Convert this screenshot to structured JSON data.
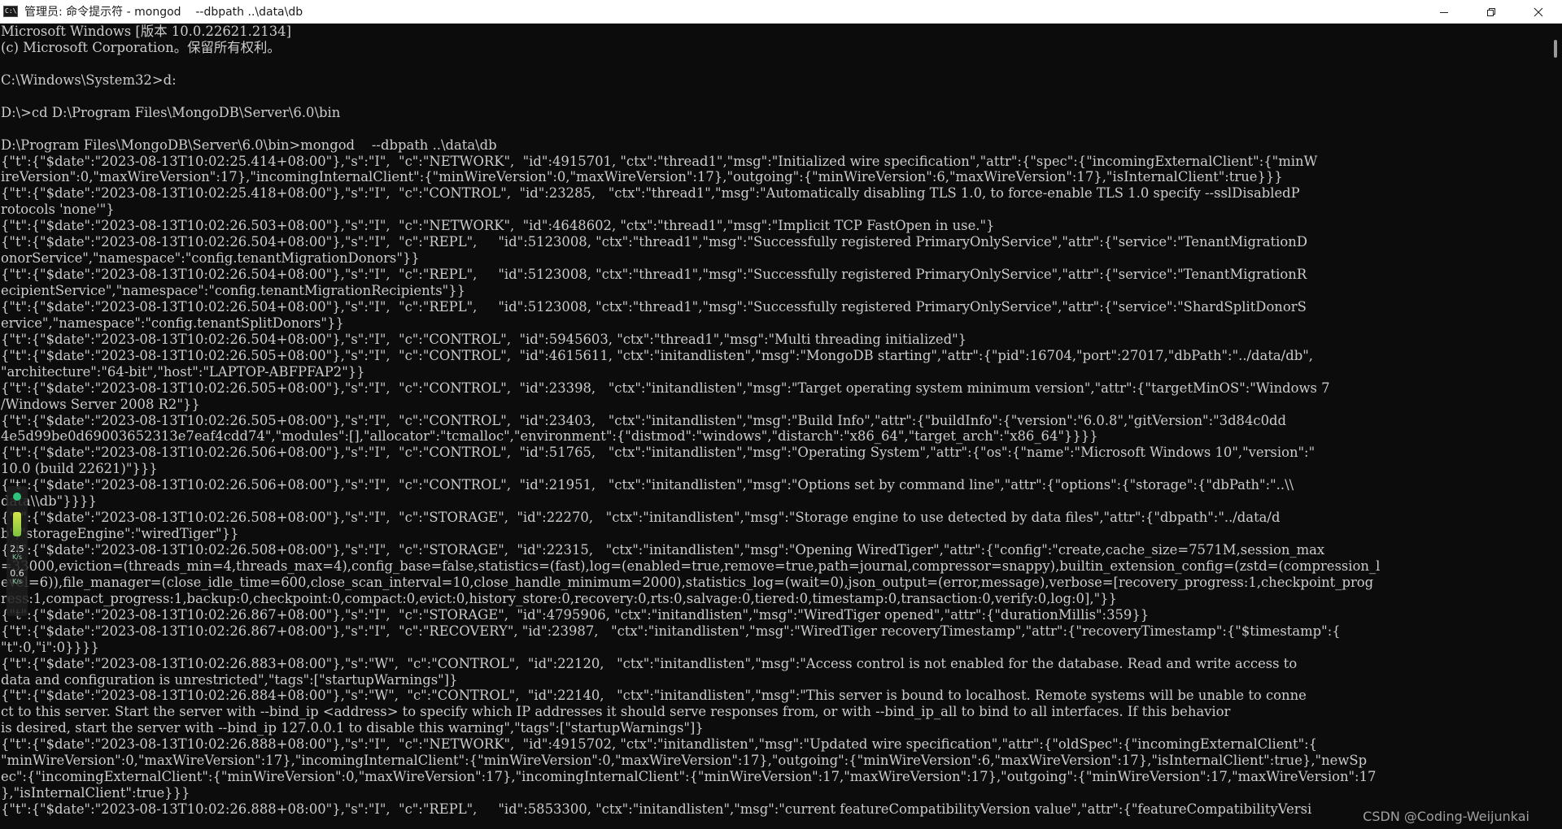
{
  "window": {
    "title": "管理员: 命令提示符 - mongod    --dbpath ..\\data\\db",
    "icon_label": "C:\\",
    "controls": [
      {
        "name": "minimize",
        "icon": "minimize-icon"
      },
      {
        "name": "restore",
        "icon": "restore-icon"
      },
      {
        "name": "close",
        "icon": "close-icon"
      }
    ]
  },
  "colors": {
    "background": "#0c0c0c",
    "text": "#cccccc",
    "titlebar": "#ffffff"
  },
  "console": {
    "lines": [
      "Microsoft Windows [版本 10.0.22621.2134]",
      "(c) Microsoft Corporation。保留所有权利。",
      "",
      "C:\\Windows\\System32>d:",
      "",
      "D:\\>cd D:\\Program Files\\MongoDB\\Server\\6.0\\bin",
      "",
      "D:\\Program Files\\MongoDB\\Server\\6.0\\bin>mongod    --dbpath ..\\data\\db",
      "{\"t\":{\"$date\":\"2023-08-13T10:02:25.414+08:00\"},\"s\":\"I\",  \"c\":\"NETWORK\",  \"id\":4915701, \"ctx\":\"thread1\",\"msg\":\"Initialized wire specification\",\"attr\":{\"spec\":{\"incomingExternalClient\":{\"minW",
      "ireVersion\":0,\"maxWireVersion\":17},\"incomingInternalClient\":{\"minWireVersion\":0,\"maxWireVersion\":17},\"outgoing\":{\"minWireVersion\":6,\"maxWireVersion\":17},\"isInternalClient\":true}}}",
      "{\"t\":{\"$date\":\"2023-08-13T10:02:25.418+08:00\"},\"s\":\"I\",  \"c\":\"CONTROL\",  \"id\":23285,   \"ctx\":\"thread1\",\"msg\":\"Automatically disabling TLS 1.0, to force-enable TLS 1.0 specify --sslDisabledP",
      "rotocols 'none'\"}",
      "{\"t\":{\"$date\":\"2023-08-13T10:02:26.503+08:00\"},\"s\":\"I\",  \"c\":\"NETWORK\",  \"id\":4648602, \"ctx\":\"thread1\",\"msg\":\"Implicit TCP FastOpen in use.\"}",
      "{\"t\":{\"$date\":\"2023-08-13T10:02:26.504+08:00\"},\"s\":\"I\",  \"c\":\"REPL\",     \"id\":5123008, \"ctx\":\"thread1\",\"msg\":\"Successfully registered PrimaryOnlyService\",\"attr\":{\"service\":\"TenantMigrationD",
      "onorService\",\"namespace\":\"config.tenantMigrationDonors\"}}",
      "{\"t\":{\"$date\":\"2023-08-13T10:02:26.504+08:00\"},\"s\":\"I\",  \"c\":\"REPL\",     \"id\":5123008, \"ctx\":\"thread1\",\"msg\":\"Successfully registered PrimaryOnlyService\",\"attr\":{\"service\":\"TenantMigrationR",
      "ecipientService\",\"namespace\":\"config.tenantMigrationRecipients\"}}",
      "{\"t\":{\"$date\":\"2023-08-13T10:02:26.504+08:00\"},\"s\":\"I\",  \"c\":\"REPL\",     \"id\":5123008, \"ctx\":\"thread1\",\"msg\":\"Successfully registered PrimaryOnlyService\",\"attr\":{\"service\":\"ShardSplitDonorS",
      "ervice\",\"namespace\":\"config.tenantSplitDonors\"}}",
      "{\"t\":{\"$date\":\"2023-08-13T10:02:26.504+08:00\"},\"s\":\"I\",  \"c\":\"CONTROL\",  \"id\":5945603, \"ctx\":\"thread1\",\"msg\":\"Multi threading initialized\"}",
      "{\"t\":{\"$date\":\"2023-08-13T10:02:26.505+08:00\"},\"s\":\"I\",  \"c\":\"CONTROL\",  \"id\":4615611, \"ctx\":\"initandlisten\",\"msg\":\"MongoDB starting\",\"attr\":{\"pid\":16704,\"port\":27017,\"dbPath\":\"../data/db\",",
      "\"architecture\":\"64-bit\",\"host\":\"LAPTOP-ABFPFAP2\"}}",
      "{\"t\":{\"$date\":\"2023-08-13T10:02:26.505+08:00\"},\"s\":\"I\",  \"c\":\"CONTROL\",  \"id\":23398,   \"ctx\":\"initandlisten\",\"msg\":\"Target operating system minimum version\",\"attr\":{\"targetMinOS\":\"Windows 7",
      "/Windows Server 2008 R2\"}}",
      "{\"t\":{\"$date\":\"2023-08-13T10:02:26.505+08:00\"},\"s\":\"I\",  \"c\":\"CONTROL\",  \"id\":23403,   \"ctx\":\"initandlisten\",\"msg\":\"Build Info\",\"attr\":{\"buildInfo\":{\"version\":\"6.0.8\",\"gitVersion\":\"3d84c0dd",
      "4e5d99be0d69003652313e7eaf4cdd74\",\"modules\":[],\"allocator\":\"tcmalloc\",\"environment\":{\"distmod\":\"windows\",\"distarch\":\"x86_64\",\"target_arch\":\"x86_64\"}}}}",
      "{\"t\":{\"$date\":\"2023-08-13T10:02:26.506+08:00\"},\"s\":\"I\",  \"c\":\"CONTROL\",  \"id\":51765,   \"ctx\":\"initandlisten\",\"msg\":\"Operating System\",\"attr\":{\"os\":{\"name\":\"Microsoft Windows 10\",\"version\":\"",
      "10.0 (build 22621)\"}}}",
      "{\"t\":{\"$date\":\"2023-08-13T10:02:26.506+08:00\"},\"s\":\"I\",  \"c\":\"CONTROL\",  \"id\":21951,   \"ctx\":\"initandlisten\",\"msg\":\"Options set by command line\",\"attr\":{\"options\":{\"storage\":{\"dbPath\":\"..\\\\",
      "data\\\\db\"}}}}",
      "{\"t\":{\"$date\":\"2023-08-13T10:02:26.508+08:00\"},\"s\":\"I\",  \"c\":\"STORAGE\",  \"id\":22270,   \"ctx\":\"initandlisten\",\"msg\":\"Storage engine to use detected by data files\",\"attr\":{\"dbpath\":\"../data/d",
      "b\",\"storageEngine\":\"wiredTiger\"}}",
      "{\"t\":{\"$date\":\"2023-08-13T10:02:26.508+08:00\"},\"s\":\"I\",  \"c\":\"STORAGE\",  \"id\":22315,   \"ctx\":\"initandlisten\",\"msg\":\"Opening WiredTiger\",\"attr\":{\"config\":\"create,cache_size=7571M,session_max",
      "=33000,eviction=(threads_min=4,threads_max=4),config_base=false,statistics=(fast),log=(enabled=true,remove=true,path=journal,compressor=snappy),builtin_extension_config=(zstd=(compression_l",
      "evel=6)),file_manager=(close_idle_time=600,close_scan_interval=10,close_handle_minimum=2000),statistics_log=(wait=0),json_output=(error,message),verbose=[recovery_progress:1,checkpoint_prog",
      "ress:1,compact_progress:1,backup:0,checkpoint:0,compact:0,evict:0,history_store:0,recovery:0,rts:0,salvage:0,tiered:0,timestamp:0,transaction:0,verify:0,log:0],\"}}",
      "{\"t\":{\"$date\":\"2023-08-13T10:02:26.867+08:00\"},\"s\":\"I\",  \"c\":\"STORAGE\",  \"id\":4795906, \"ctx\":\"initandlisten\",\"msg\":\"WiredTiger opened\",\"attr\":{\"durationMillis\":359}}",
      "{\"t\":{\"$date\":\"2023-08-13T10:02:26.867+08:00\"},\"s\":\"I\",  \"c\":\"RECOVERY\", \"id\":23987,   \"ctx\":\"initandlisten\",\"msg\":\"WiredTiger recoveryTimestamp\",\"attr\":{\"recoveryTimestamp\":{\"$timestamp\":{",
      "\"t\":0,\"i\":0}}}}",
      "{\"t\":{\"$date\":\"2023-08-13T10:02:26.883+08:00\"},\"s\":\"W\",  \"c\":\"CONTROL\",  \"id\":22120,   \"ctx\":\"initandlisten\",\"msg\":\"Access control is not enabled for the database. Read and write access to",
      "data and configuration is unrestricted\",\"tags\":[\"startupWarnings\"]}",
      "{\"t\":{\"$date\":\"2023-08-13T10:02:26.884+08:00\"},\"s\":\"W\",  \"c\":\"CONTROL\",  \"id\":22140,   \"ctx\":\"initandlisten\",\"msg\":\"This server is bound to localhost. Remote systems will be unable to conne",
      "ct to this server. Start the server with --bind_ip <address> to specify which IP addresses it should serve responses from, or with --bind_ip_all to bind to all interfaces. If this behavior",
      "is desired, start the server with --bind_ip 127.0.0.1 to disable this warning\",\"tags\":[\"startupWarnings\"]}",
      "{\"t\":{\"$date\":\"2023-08-13T10:02:26.888+08:00\"},\"s\":\"I\",  \"c\":\"NETWORK\",  \"id\":4915702, \"ctx\":\"initandlisten\",\"msg\":\"Updated wire specification\",\"attr\":{\"oldSpec\":{\"incomingExternalClient\":{",
      "\"minWireVersion\":0,\"maxWireVersion\":17},\"incomingInternalClient\":{\"minWireVersion\":0,\"maxWireVersion\":17},\"outgoing\":{\"minWireVersion\":6,\"maxWireVersion\":17},\"isInternalClient\":true},\"newSp",
      "ec\":{\"incomingExternalClient\":{\"minWireVersion\":0,\"maxWireVersion\":17},\"incomingInternalClient\":{\"minWireVersion\":17,\"maxWireVersion\":17},\"outgoing\":{\"minWireVersion\":17,\"maxWireVersion\":17",
      "},\"isInternalClient\":true}}}",
      "{\"t\":{\"$date\":\"2023-08-13T10:02:26.888+08:00\"},\"s\":\"I\",  \"c\":\"REPL\",     \"id\":5853300, \"ctx\":\"initandlisten\",\"msg\":\"current featureCompatibilityVersion value\",\"attr\":{\"featureCompatibilityVersi"
    ]
  },
  "overlay": {
    "upload_value": "2.5",
    "upload_unit": "K/s",
    "download_value": "0.6",
    "download_unit": "K/s"
  },
  "watermark": "CSDN @Coding-Weijunkai"
}
